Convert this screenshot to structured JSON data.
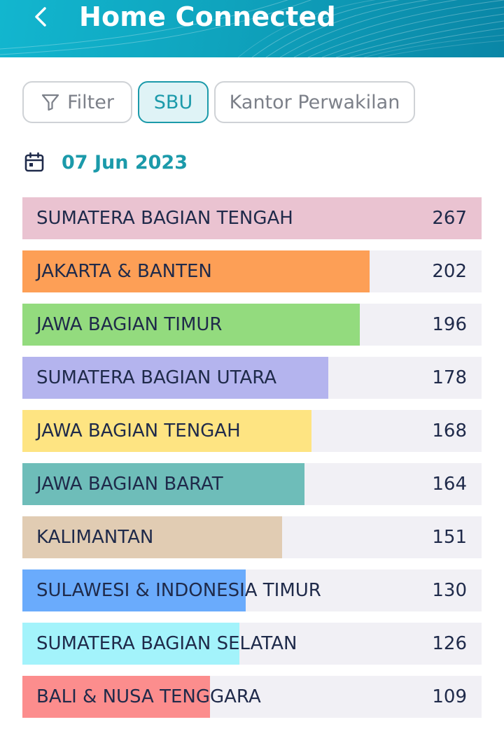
{
  "header": {
    "title": "Home Connected",
    "back_icon": "chevron-left-icon",
    "colors": {
      "start": "#12b6cf",
      "end": "#0a86a6"
    }
  },
  "filters": {
    "filter_label": "Filter",
    "filter_icon": "funnel-icon",
    "chips": [
      {
        "label": "SBU",
        "active": true
      },
      {
        "label": "Kantor Perwakilan",
        "active": false
      }
    ]
  },
  "date": {
    "icon": "calendar-icon",
    "value": "07 Jun 2023"
  },
  "chart_data": {
    "type": "bar",
    "orientation": "horizontal",
    "max": 267,
    "rows": [
      {
        "label": "SUMATERA BAGIAN TENGAH",
        "value": 267,
        "color": "#eac3d1"
      },
      {
        "label": "JAKARTA & BANTEN",
        "value": 202,
        "color": "#fd9f56"
      },
      {
        "label": "JAWA BAGIAN TIMUR",
        "value": 196,
        "color": "#93db7e"
      },
      {
        "label": "SUMATERA BAGIAN UTARA",
        "value": 178,
        "color": "#b4b4ee"
      },
      {
        "label": "JAWA BAGIAN TENGAH",
        "value": 168,
        "color": "#fee482"
      },
      {
        "label": "JAWA BAGIAN BARAT",
        "value": 164,
        "color": "#6ebdb9"
      },
      {
        "label": "KALIMANTAN",
        "value": 151,
        "color": "#e1ccb3"
      },
      {
        "label": "SULAWESI & INDONESIA TIMUR",
        "value": 130,
        "color": "#6aabfc"
      },
      {
        "label": "SUMATERA BAGIAN SELATAN",
        "value": 126,
        "color": "#a3f3fb"
      },
      {
        "label": "BALI & NUSA TENGGARA",
        "value": 109,
        "color": "#fc8d8d"
      }
    ]
  }
}
